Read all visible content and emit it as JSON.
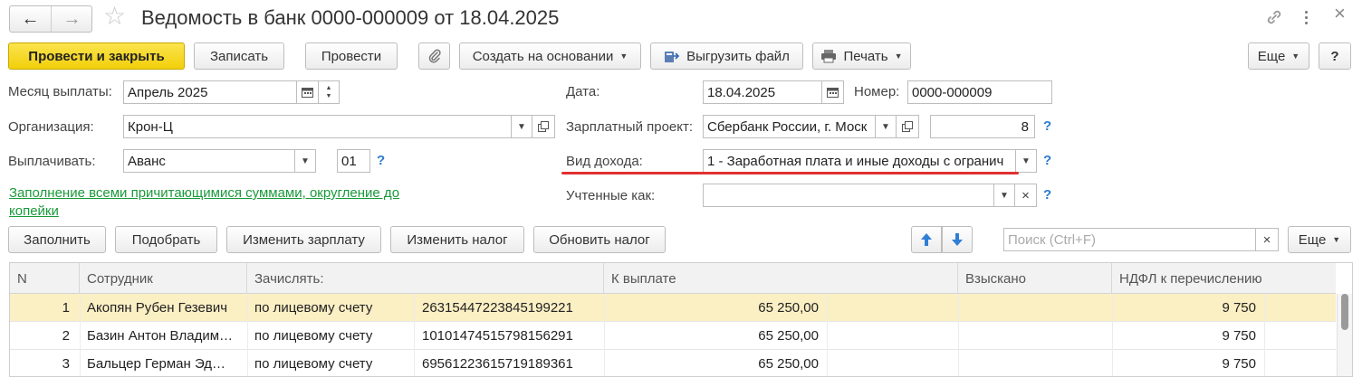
{
  "window": {
    "title": "Ведомость в банк 0000-000009 от 18.04.2025"
  },
  "toolbar": {
    "post_close": "Провести и закрыть",
    "save": "Записать",
    "post": "Провести",
    "create_based": "Создать на основании",
    "export_file": "Выгрузить файл",
    "print": "Печать",
    "more": "Еще",
    "help": "?"
  },
  "form": {
    "month_label": "Месяц выплаты:",
    "month_value": "Апрель 2025",
    "org_label": "Организация:",
    "org_value": "Крон-Ц",
    "pay_label": "Выплачивать:",
    "pay_value": "Аванс",
    "pay_code": "01",
    "fill_link": "Заполнение всеми причитающимися суммами, округление до копейки",
    "date_label": "Дата:",
    "date_value": "18.04.2025",
    "number_label": "Номер:",
    "number_value": "0000-000009",
    "project_label": "Зарплатный проект:",
    "project_value": "Сбербанк России, г. Моск",
    "project_code": "8",
    "income_label": "Вид дохода:",
    "income_value": "1 - Заработная плата и иные доходы с огранич",
    "accounted_label": "Учтенные как:",
    "accounted_value": "",
    "help": "?"
  },
  "table_toolbar": {
    "fill": "Заполнить",
    "pick": "Подобрать",
    "change_salary": "Изменить зарплату",
    "change_tax": "Изменить налог",
    "update_tax": "Обновить налог",
    "search_placeholder": "Поиск (Ctrl+F)",
    "more": "Еще"
  },
  "table": {
    "columns": [
      "N",
      "Сотрудник",
      "Зачислять:",
      "К выплате",
      "Взыскано",
      "НДФЛ к перечислению"
    ],
    "rows": [
      {
        "n": "1",
        "employee": "Акопян Рубен Гезевич",
        "method": "по лицевому счету",
        "account": "26315447223845199221",
        "amount": "65 250,00",
        "withheld": "",
        "ndfl": "9 750"
      },
      {
        "n": "2",
        "employee": "Базин Антон Владим…",
        "method": "по лицевому счету",
        "account": "10101474515798156291",
        "amount": "65 250,00",
        "withheld": "",
        "ndfl": "9 750"
      },
      {
        "n": "3",
        "employee": "Бальцер Герман Эд…",
        "method": "по лицевому счету",
        "account": "69561223615719189361",
        "amount": "65 250,00",
        "withheld": "",
        "ndfl": "9 750"
      }
    ]
  },
  "colors": {
    "accent_yellow": "#f2cf0b",
    "selected_row": "#fbefc4",
    "link_green": "#1a9a3a",
    "help_blue": "#2a7bd1",
    "underline_red": "#e03030"
  }
}
